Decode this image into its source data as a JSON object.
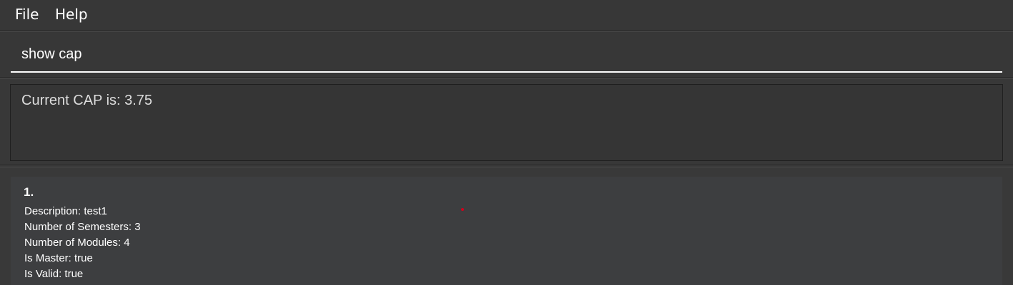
{
  "menu": {
    "file_label": "File",
    "help_label": "Help"
  },
  "command": {
    "value": "show cap"
  },
  "result": {
    "text": "Current CAP is: 3.75"
  },
  "list": {
    "items": [
      {
        "index": "1.",
        "description": "Description: test1",
        "semesters": "Number of Semesters: 3",
        "modules": "Number of Modules: 4",
        "is_master": "Is Master: true",
        "is_valid": "Is Valid: true"
      }
    ]
  },
  "colors": {
    "background": "#3a3a3a",
    "card": "#3d3e40",
    "text": "#ffffff",
    "cursor_dot": "#d0021b"
  }
}
